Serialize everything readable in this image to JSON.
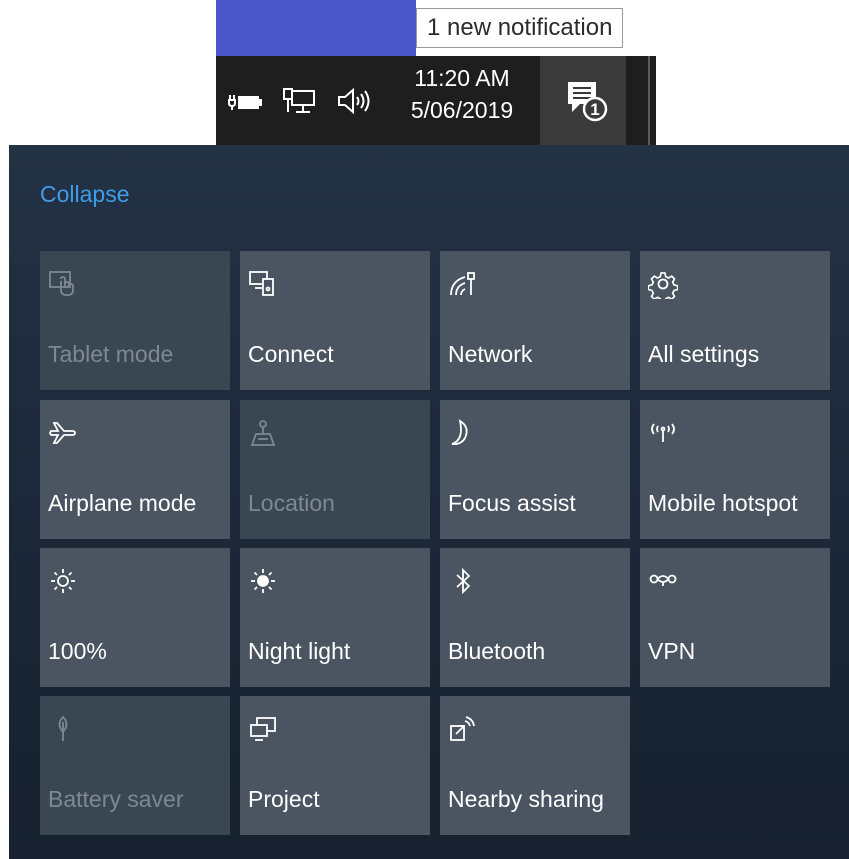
{
  "tooltip": {
    "text": "1 new notification"
  },
  "tray": {
    "time": "11:20 AM",
    "date": "5/06/2019",
    "notification_count": "1",
    "icons": [
      "battery-icon",
      "network-icon",
      "volume-icon",
      "action-center-icon"
    ]
  },
  "action_center": {
    "collapse_label": "Collapse",
    "tiles": [
      {
        "label": "Tablet mode",
        "icon": "tablet-mode-icon",
        "enabled": false
      },
      {
        "label": "Connect",
        "icon": "connect-icon",
        "enabled": true
      },
      {
        "label": "Network",
        "icon": "network-icon",
        "enabled": true
      },
      {
        "label": "All settings",
        "icon": "gear-icon",
        "enabled": true
      },
      {
        "label": "Airplane mode",
        "icon": "airplane-icon",
        "enabled": true
      },
      {
        "label": "Location",
        "icon": "location-icon",
        "enabled": false
      },
      {
        "label": "Focus assist",
        "icon": "moon-icon",
        "enabled": true
      },
      {
        "label": "Mobile hotspot",
        "icon": "hotspot-icon",
        "enabled": true
      },
      {
        "label": "100%",
        "icon": "brightness-icon",
        "enabled": true
      },
      {
        "label": "Night light",
        "icon": "night-light-icon",
        "enabled": true
      },
      {
        "label": "Bluetooth",
        "icon": "bluetooth-icon",
        "enabled": true
      },
      {
        "label": "VPN",
        "icon": "vpn-icon",
        "enabled": true
      },
      {
        "label": "Battery saver",
        "icon": "battery-saver-icon",
        "enabled": false
      },
      {
        "label": "Project",
        "icon": "project-icon",
        "enabled": true
      },
      {
        "label": "Nearby sharing",
        "icon": "nearby-sharing-icon",
        "enabled": true
      }
    ]
  },
  "colors": {
    "accent": "#3f9de8",
    "window_strip": "#4a57c8",
    "taskbar": "#1e1e1e",
    "tile": "#4a5561",
    "tile_disabled_text": "#7d8894"
  }
}
